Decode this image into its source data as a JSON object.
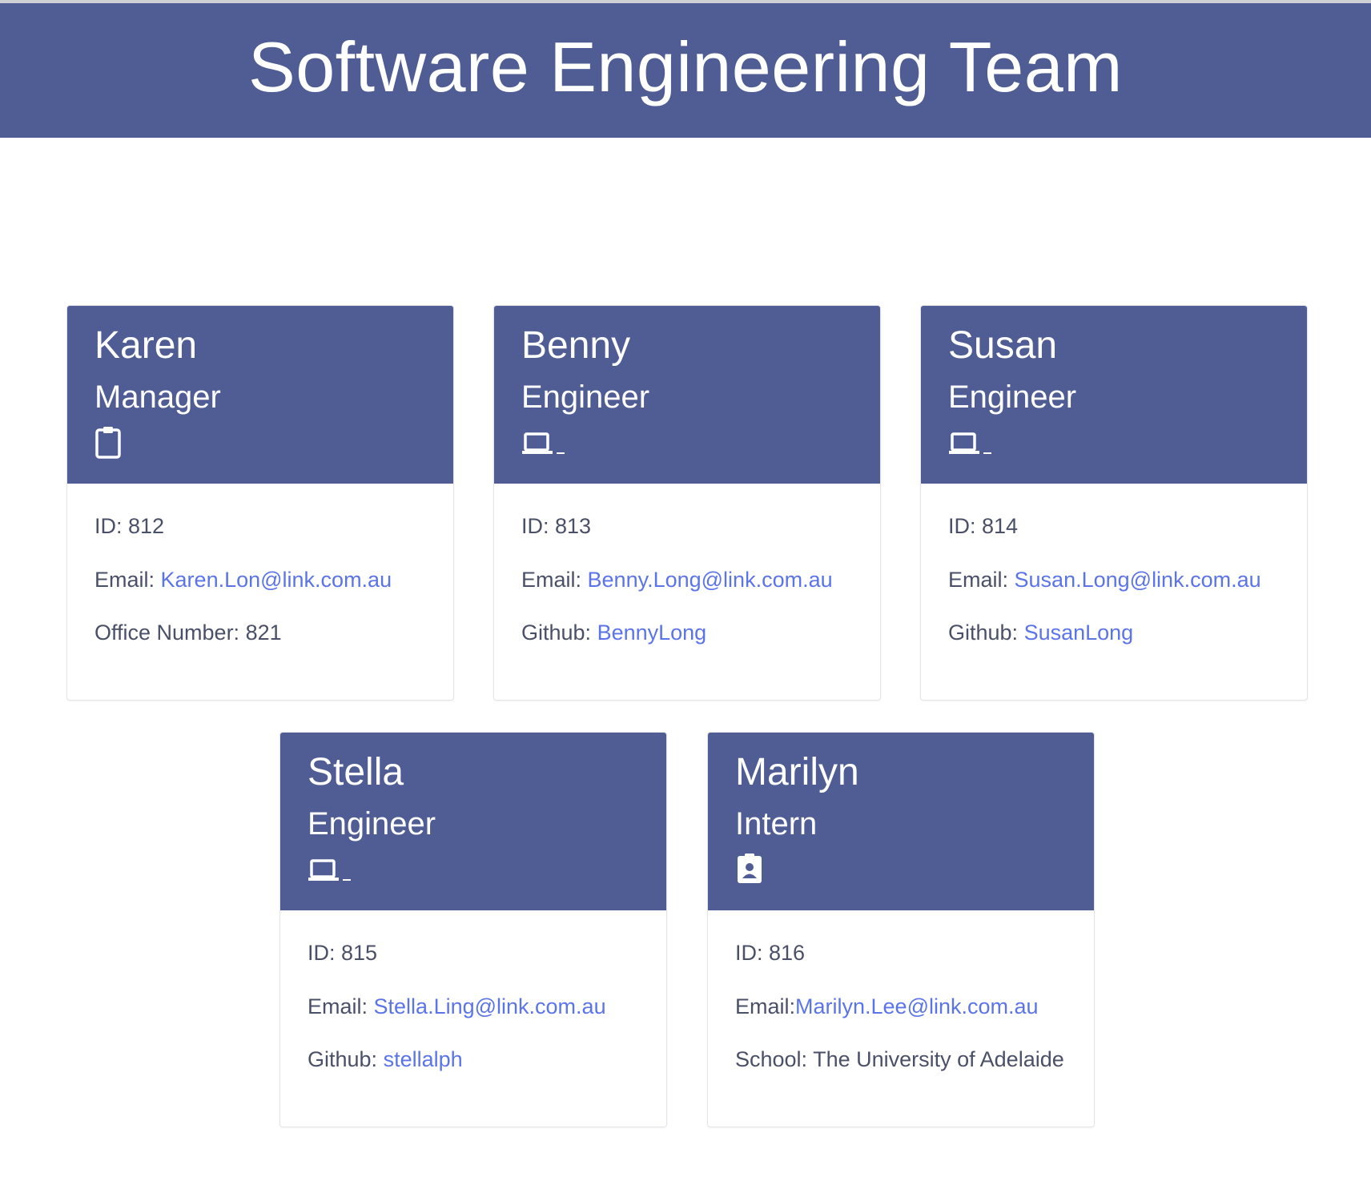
{
  "page": {
    "title": "Software Engineering Team",
    "colors": {
      "header": "#4f5d94",
      "link": "#5b74e8",
      "text": "#4a5068"
    }
  },
  "cards": [
    {
      "name": "Karen",
      "role": "Manager",
      "icon": "clipboard-icon",
      "id_label": "ID: 812",
      "email_label": "Email: ",
      "email": "Karen.Lon@link.com.au",
      "extra_label": "Office Number: 821",
      "extra_link": ""
    },
    {
      "name": "Benny",
      "role": "Engineer",
      "icon": "laptop-icon",
      "id_label": "ID: 813",
      "email_label": "Email: ",
      "email": "Benny.Long@link.com.au",
      "extra_label": "Github: ",
      "extra_link": "BennyLong"
    },
    {
      "name": "Susan",
      "role": "Engineer",
      "icon": "laptop-icon",
      "id_label": "ID: 814",
      "email_label": "Email: ",
      "email": "Susan.Long@link.com.au",
      "extra_label": "Github: ",
      "extra_link": "SusanLong"
    },
    {
      "name": "Stella",
      "role": "Engineer",
      "icon": "laptop-icon",
      "id_label": "ID: 815",
      "email_label": "Email: ",
      "email": "Stella.Ling@link.com.au",
      "extra_label": "Github: ",
      "extra_link": "stellalph"
    },
    {
      "name": "Marilyn",
      "role": "Intern",
      "icon": "id-badge-icon",
      "id_label": "ID: 816",
      "email_label": "Email:",
      "email": "Marilyn.Lee@link.com.au",
      "extra_label": "School: The University of Adelaide",
      "extra_link": ""
    }
  ]
}
